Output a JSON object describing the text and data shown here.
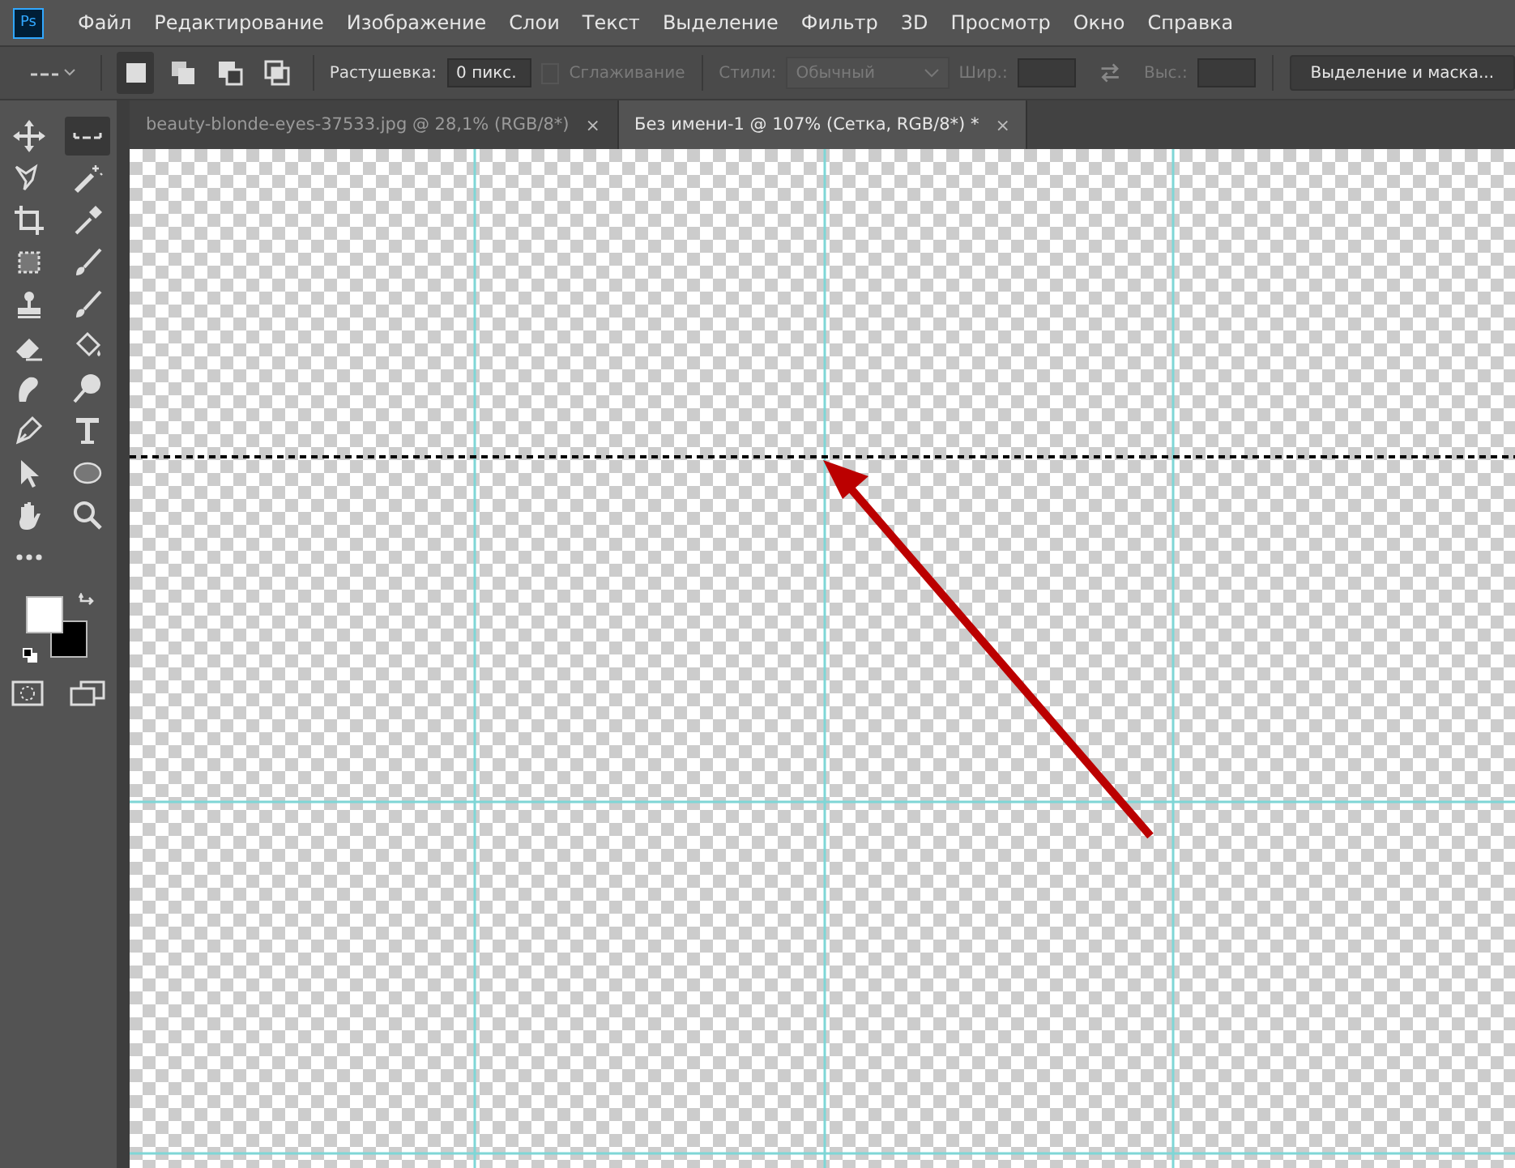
{
  "app": {
    "logo": "Ps"
  },
  "menu": [
    "Файл",
    "Редактирование",
    "Изображение",
    "Слои",
    "Текст",
    "Выделение",
    "Фильтр",
    "3D",
    "Просмотр",
    "Окно",
    "Справка"
  ],
  "options": {
    "modes": [
      {
        "kind": "new",
        "selected": true
      },
      {
        "kind": "add",
        "selected": false
      },
      {
        "kind": "subtract",
        "selected": false
      },
      {
        "kind": "intersect",
        "selected": false
      }
    ],
    "feather_label": "Растушевка:",
    "feather_value": "0 пикс.",
    "antialias": {
      "label": "Сглаживание",
      "checked": false,
      "disabled": true
    },
    "style_label": "Стили:",
    "style_value": "Обычный",
    "style_disabled": true,
    "width_label": "Шир.:",
    "height_label": "Выс.:",
    "mask_button": "Выделение и маска..."
  },
  "tabs": [
    {
      "title": "beauty-blonde-eyes-37533.jpg @ 28,1% (RGB/8*)",
      "close": "×",
      "selected": false
    },
    {
      "title": "Без имени-1 @ 107% (Сетка, RGB/8*) *",
      "close": "×",
      "selected": true
    }
  ],
  "tools": [
    {
      "kind": "move",
      "selected": false
    },
    {
      "kind": "marquee",
      "selected": true
    },
    {
      "kind": "lasso",
      "selected": false
    },
    {
      "kind": "wand",
      "selected": false
    },
    {
      "kind": "crop",
      "selected": false
    },
    {
      "kind": "eyedropper",
      "selected": false
    },
    {
      "kind": "frame",
      "selected": false
    },
    {
      "kind": "brush",
      "selected": false
    },
    {
      "kind": "stamp",
      "selected": false
    },
    {
      "kind": "history",
      "selected": false
    },
    {
      "kind": "eraser",
      "selected": false
    },
    {
      "kind": "bucket",
      "selected": false
    },
    {
      "kind": "smudge",
      "selected": false
    },
    {
      "kind": "dodge",
      "selected": false
    },
    {
      "kind": "pen",
      "selected": false
    },
    {
      "kind": "type",
      "selected": false
    },
    {
      "kind": "select",
      "selected": false
    },
    {
      "kind": "ellipse",
      "selected": false
    },
    {
      "kind": "hand",
      "selected": false
    },
    {
      "kind": "zoom",
      "selected": false
    },
    {
      "kind": "more",
      "selected": false
    }
  ]
}
